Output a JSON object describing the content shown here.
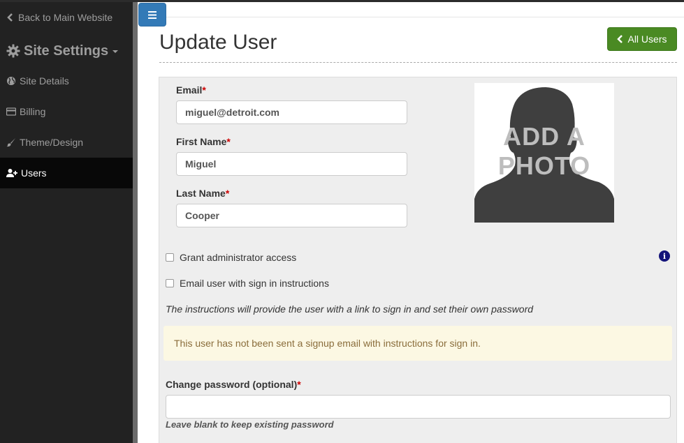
{
  "sidebar": {
    "back_label": "Back to Main Website",
    "settings_label": "Site Settings",
    "items": [
      {
        "label": "Site Details",
        "icon": "globe-icon"
      },
      {
        "label": "Billing",
        "icon": "credit-card-icon"
      },
      {
        "label": "Theme/Design",
        "icon": "paint-brush-icon"
      },
      {
        "label": "Users",
        "icon": "user-plus-icon",
        "active": true
      }
    ]
  },
  "header": {
    "title": "Update User",
    "all_users_label": "All Users"
  },
  "form": {
    "email_label": "Email",
    "email_value": "miguel@detroit.com",
    "first_name_label": "First Name",
    "first_name_value": "Miguel",
    "last_name_label": "Last Name",
    "last_name_value": "Cooper",
    "required_mark": "*",
    "photo_text_line1": "ADD A",
    "photo_text_line2": "PHOTO",
    "grant_admin_label": "Grant administrator access",
    "grant_admin_checked": false,
    "email_instructions_label": "Email user with sign in instructions",
    "email_instructions_checked": false,
    "instructions_note": "The instructions will provide the user with a link to sign in and set their own password",
    "alert_text": "This user has not been sent a signup email with instructions for sign in.",
    "password_label": "Change password (optional)",
    "password_value": "",
    "password_help": "Leave blank to keep existing password",
    "info_icon_glyph": "i"
  },
  "colors": {
    "sidebar_bg": "#222222",
    "primary": "#337ab7",
    "success": "#4a8a23",
    "alert_bg": "#fcf8e3",
    "alert_text": "#8a6d3b",
    "required": "#cc0000"
  }
}
